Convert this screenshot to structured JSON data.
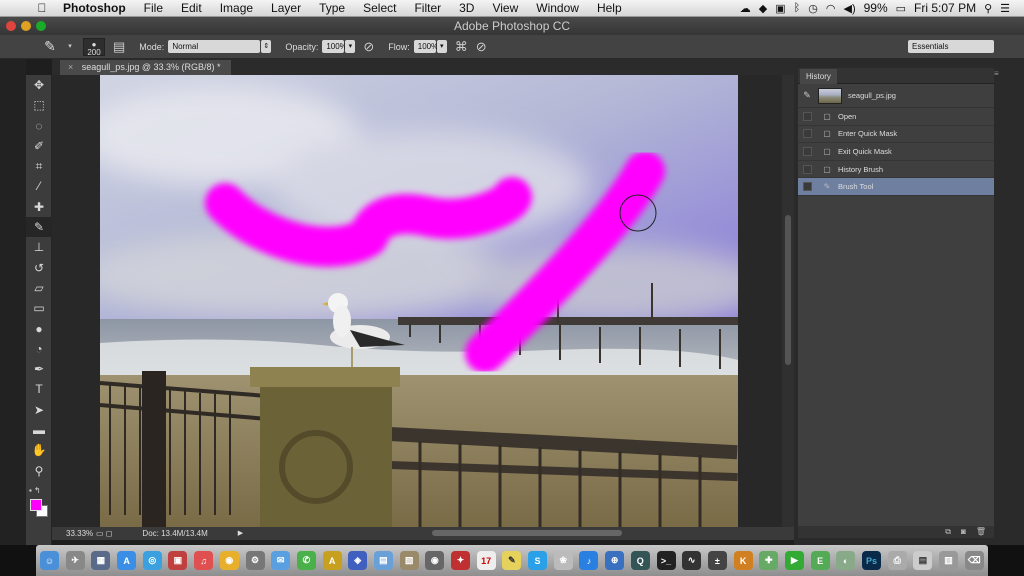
{
  "menubar": {
    "apple": "",
    "menus": [
      "Photoshop",
      "File",
      "Edit",
      "Image",
      "Layer",
      "Type",
      "Select",
      "Filter",
      "3D",
      "View",
      "Window",
      "Help"
    ],
    "battery": "99%",
    "clock": "Fri 5:07 PM"
  },
  "window": {
    "title": "Adobe Photoshop CC"
  },
  "options": {
    "brush_size": "200",
    "mode_label": "Mode:",
    "mode_value": "Normal",
    "opacity_label": "Opacity:",
    "opacity_value": "100%",
    "flow_label": "Flow:",
    "flow_value": "100%",
    "workspace": "Essentials"
  },
  "document": {
    "tab_label": "seagull_ps.jpg @ 33.3% (RGB/8) *",
    "close": "×"
  },
  "status": {
    "zoom": "33.33%",
    "doc_info": "Doc: 13.4M/13.4M"
  },
  "history": {
    "panel_title": "History",
    "snapshot_name": "seagull_ps.jpg",
    "states": [
      {
        "label": "Open",
        "icon": "document-icon"
      },
      {
        "label": "Enter Quick Mask",
        "icon": "document-icon"
      },
      {
        "label": "Exit Quick Mask",
        "icon": "document-icon"
      },
      {
        "label": "History Brush",
        "icon": "document-icon"
      },
      {
        "label": "Brush Tool",
        "icon": "brush-icon",
        "active": true
      }
    ]
  },
  "colors": {
    "foreground": "#ff00ff",
    "background": "#ffffff",
    "highlight": "#6e7fa0"
  }
}
